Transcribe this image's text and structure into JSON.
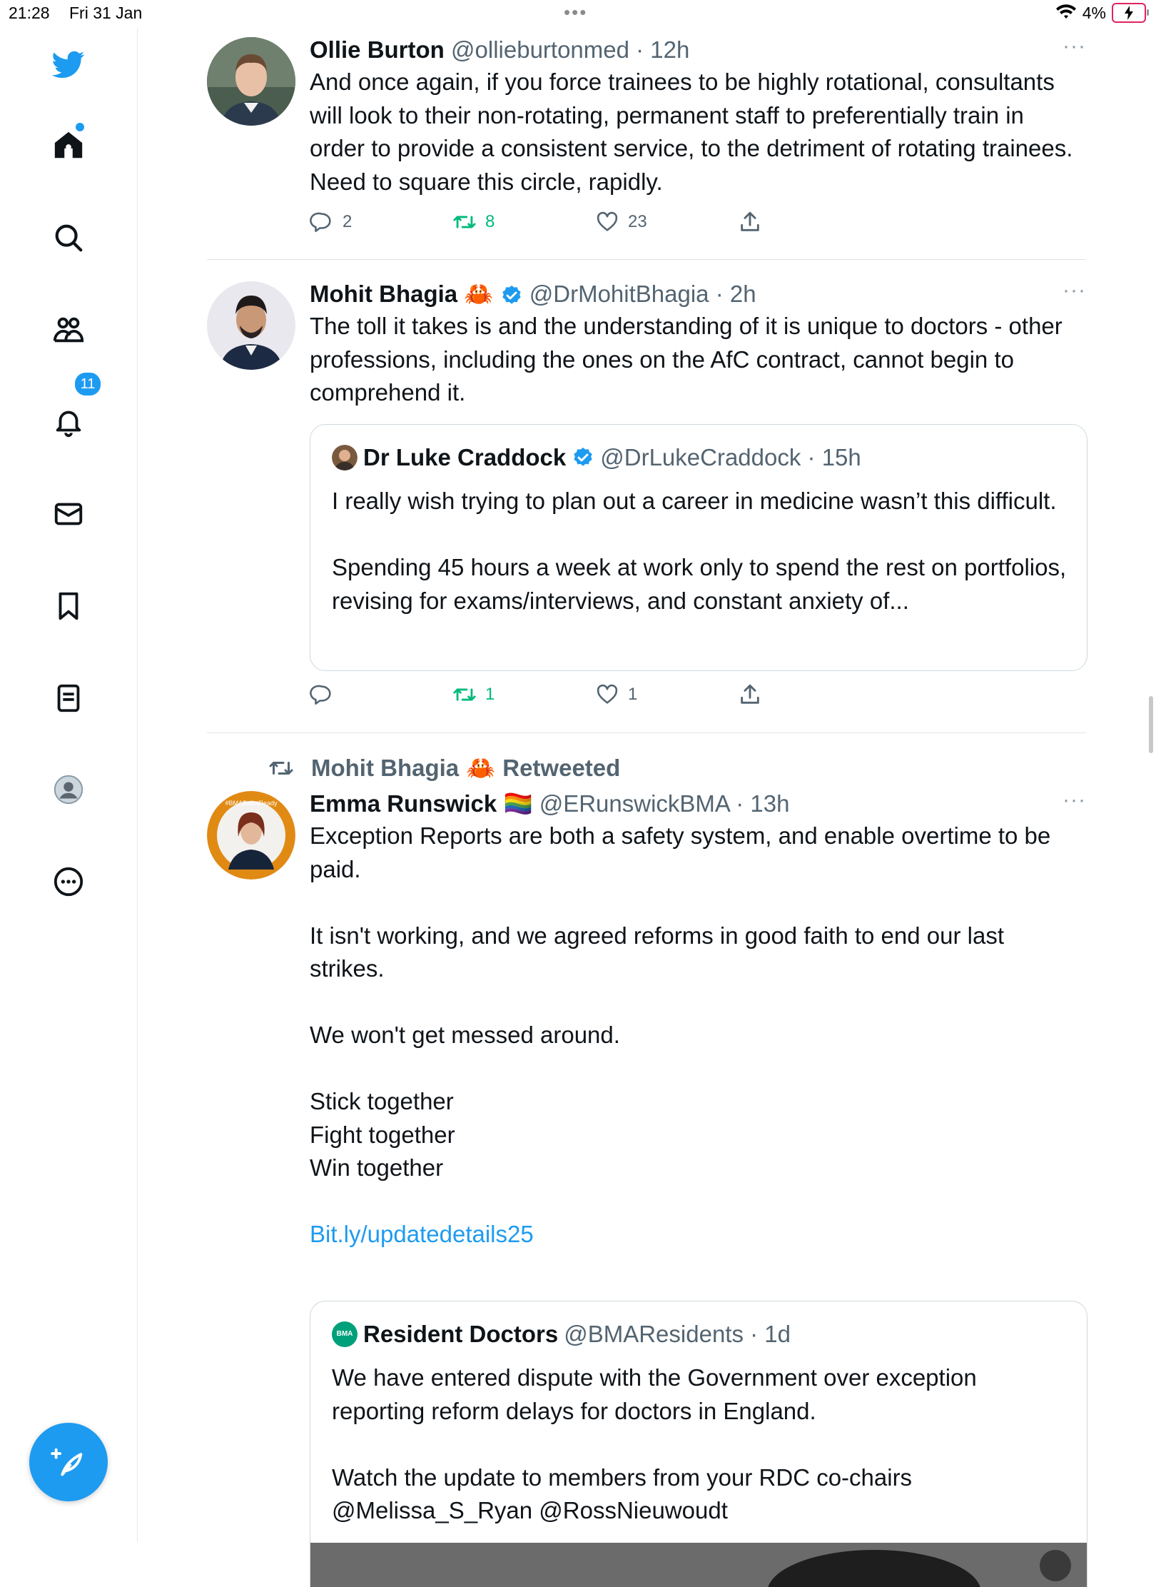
{
  "status_bar": {
    "time": "21:28",
    "date": "Fri 31 Jan",
    "dots": "•••",
    "battery": "4%"
  },
  "sidebar": {
    "notifications_count": "11",
    "items": [
      "twitter-logo",
      "home",
      "explore",
      "communities",
      "notifications",
      "messages",
      "bookmarks",
      "lists",
      "profile",
      "more"
    ]
  },
  "tweets": [
    {
      "name": "Ollie Burton",
      "handle": "@ollieburtonmed · 12h",
      "text": "And once again, if you force trainees to be highly rotational, consultants will look to their non-rotating, permanent staff to preferentially train in order to provide a consistent service, to the detriment of rotating trainees. Need to square this circle, rapidly.",
      "replies": "2",
      "retweets": "8",
      "likes": "23"
    },
    {
      "name": "Mohit Bhagia",
      "emoji": "🦀",
      "handle": "@DrMohitBhagia · 2h",
      "text": "The toll it takes is and the understanding of it is unique to doctors - other professions, including the ones on the AfC contract, cannot begin to comprehend it.",
      "quote": {
        "name": "Dr Luke Craddock",
        "handle": "@DrLukeCraddock · 15h",
        "text": "I really wish trying to plan out a career in medicine wasn’t this difficult.\n\nSpending 45 hours a week at work only to spend the rest on portfolios, revising for exams/interviews, and constant anxiety of..."
      },
      "replies": "",
      "retweets": "1",
      "likes": "1"
    },
    {
      "retweeted_by": "Mohit Bhagia",
      "retweeted_emoji": "🦀",
      "retweeted_label": "Retweeted",
      "name": "Emma Runswick",
      "emoji": "🏳️‍🌈",
      "handle": "@ERunswickBMA · 13h",
      "text": "Exception Reports are both a safety system, and enable overtime to be paid.\n\nIt isn't working, and we agreed reforms in good faith to end our last strikes.\n\nWe won't get messed around.\n\nStick together\nFight together\nWin together",
      "link": "Bit.ly/updatedetails25",
      "avatar_ring_text": "I'm #BMABallotReady · Vote Yes for strike action",
      "quote": {
        "avatar_label": "BMA",
        "name": "Resident Doctors",
        "handle": "@BMAResidents · 1d",
        "text": "We have entered dispute with the Government over exception reporting reform delays for doctors in England.\n\nWatch the update to members from your RDC co-chairs @Melissa_S_Ryan @RossNieuwoudt"
      }
    }
  ],
  "colors": {
    "accent": "#1d9bf0",
    "retweet": "#00ba7c",
    "secondary": "#536471",
    "border": "#cfd9de"
  },
  "icons": {
    "more": "more-horizontal-icon",
    "reply": "reply-icon",
    "retweet": "retweet-icon",
    "like": "heart-icon",
    "share": "share-icon"
  }
}
